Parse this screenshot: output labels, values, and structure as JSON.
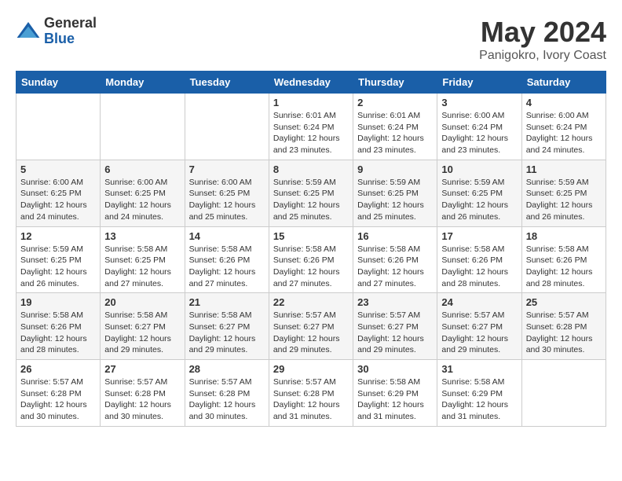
{
  "logo": {
    "general": "General",
    "blue": "Blue"
  },
  "header": {
    "month": "May 2024",
    "location": "Panigokro, Ivory Coast"
  },
  "weekdays": [
    "Sunday",
    "Monday",
    "Tuesday",
    "Wednesday",
    "Thursday",
    "Friday",
    "Saturday"
  ],
  "weeks": [
    [
      {
        "day": "",
        "info": ""
      },
      {
        "day": "",
        "info": ""
      },
      {
        "day": "",
        "info": ""
      },
      {
        "day": "1",
        "info": "Sunrise: 6:01 AM\nSunset: 6:24 PM\nDaylight: 12 hours\nand 23 minutes."
      },
      {
        "day": "2",
        "info": "Sunrise: 6:01 AM\nSunset: 6:24 PM\nDaylight: 12 hours\nand 23 minutes."
      },
      {
        "day": "3",
        "info": "Sunrise: 6:00 AM\nSunset: 6:24 PM\nDaylight: 12 hours\nand 23 minutes."
      },
      {
        "day": "4",
        "info": "Sunrise: 6:00 AM\nSunset: 6:24 PM\nDaylight: 12 hours\nand 24 minutes."
      }
    ],
    [
      {
        "day": "5",
        "info": "Sunrise: 6:00 AM\nSunset: 6:25 PM\nDaylight: 12 hours\nand 24 minutes."
      },
      {
        "day": "6",
        "info": "Sunrise: 6:00 AM\nSunset: 6:25 PM\nDaylight: 12 hours\nand 24 minutes."
      },
      {
        "day": "7",
        "info": "Sunrise: 6:00 AM\nSunset: 6:25 PM\nDaylight: 12 hours\nand 25 minutes."
      },
      {
        "day": "8",
        "info": "Sunrise: 5:59 AM\nSunset: 6:25 PM\nDaylight: 12 hours\nand 25 minutes."
      },
      {
        "day": "9",
        "info": "Sunrise: 5:59 AM\nSunset: 6:25 PM\nDaylight: 12 hours\nand 25 minutes."
      },
      {
        "day": "10",
        "info": "Sunrise: 5:59 AM\nSunset: 6:25 PM\nDaylight: 12 hours\nand 26 minutes."
      },
      {
        "day": "11",
        "info": "Sunrise: 5:59 AM\nSunset: 6:25 PM\nDaylight: 12 hours\nand 26 minutes."
      }
    ],
    [
      {
        "day": "12",
        "info": "Sunrise: 5:59 AM\nSunset: 6:25 PM\nDaylight: 12 hours\nand 26 minutes."
      },
      {
        "day": "13",
        "info": "Sunrise: 5:58 AM\nSunset: 6:25 PM\nDaylight: 12 hours\nand 27 minutes."
      },
      {
        "day": "14",
        "info": "Sunrise: 5:58 AM\nSunset: 6:26 PM\nDaylight: 12 hours\nand 27 minutes."
      },
      {
        "day": "15",
        "info": "Sunrise: 5:58 AM\nSunset: 6:26 PM\nDaylight: 12 hours\nand 27 minutes."
      },
      {
        "day": "16",
        "info": "Sunrise: 5:58 AM\nSunset: 6:26 PM\nDaylight: 12 hours\nand 27 minutes."
      },
      {
        "day": "17",
        "info": "Sunrise: 5:58 AM\nSunset: 6:26 PM\nDaylight: 12 hours\nand 28 minutes."
      },
      {
        "day": "18",
        "info": "Sunrise: 5:58 AM\nSunset: 6:26 PM\nDaylight: 12 hours\nand 28 minutes."
      }
    ],
    [
      {
        "day": "19",
        "info": "Sunrise: 5:58 AM\nSunset: 6:26 PM\nDaylight: 12 hours\nand 28 minutes."
      },
      {
        "day": "20",
        "info": "Sunrise: 5:58 AM\nSunset: 6:27 PM\nDaylight: 12 hours\nand 29 minutes."
      },
      {
        "day": "21",
        "info": "Sunrise: 5:58 AM\nSunset: 6:27 PM\nDaylight: 12 hours\nand 29 minutes."
      },
      {
        "day": "22",
        "info": "Sunrise: 5:57 AM\nSunset: 6:27 PM\nDaylight: 12 hours\nand 29 minutes."
      },
      {
        "day": "23",
        "info": "Sunrise: 5:57 AM\nSunset: 6:27 PM\nDaylight: 12 hours\nand 29 minutes."
      },
      {
        "day": "24",
        "info": "Sunrise: 5:57 AM\nSunset: 6:27 PM\nDaylight: 12 hours\nand 29 minutes."
      },
      {
        "day": "25",
        "info": "Sunrise: 5:57 AM\nSunset: 6:28 PM\nDaylight: 12 hours\nand 30 minutes."
      }
    ],
    [
      {
        "day": "26",
        "info": "Sunrise: 5:57 AM\nSunset: 6:28 PM\nDaylight: 12 hours\nand 30 minutes."
      },
      {
        "day": "27",
        "info": "Sunrise: 5:57 AM\nSunset: 6:28 PM\nDaylight: 12 hours\nand 30 minutes."
      },
      {
        "day": "28",
        "info": "Sunrise: 5:57 AM\nSunset: 6:28 PM\nDaylight: 12 hours\nand 30 minutes."
      },
      {
        "day": "29",
        "info": "Sunrise: 5:57 AM\nSunset: 6:28 PM\nDaylight: 12 hours\nand 31 minutes."
      },
      {
        "day": "30",
        "info": "Sunrise: 5:58 AM\nSunset: 6:29 PM\nDaylight: 12 hours\nand 31 minutes."
      },
      {
        "day": "31",
        "info": "Sunrise: 5:58 AM\nSunset: 6:29 PM\nDaylight: 12 hours\nand 31 minutes."
      },
      {
        "day": "",
        "info": ""
      }
    ]
  ]
}
